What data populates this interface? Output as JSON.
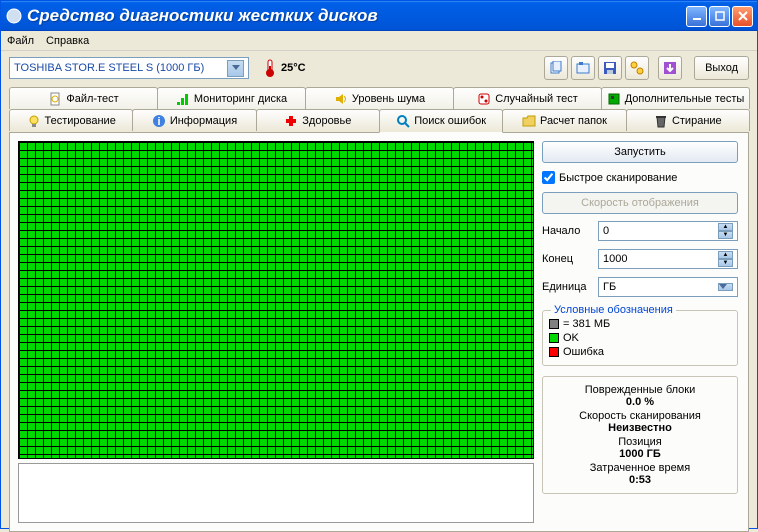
{
  "window": {
    "title": "Средство диагностики жестких дисков"
  },
  "menu": {
    "file": "Файл",
    "help": "Справка"
  },
  "toolbar": {
    "drive": "TOSHIBA STOR.E STEEL S  (1000 ГБ)",
    "temp": "25°C",
    "exit": "Выход"
  },
  "tabs_row1": [
    "Файл-тест",
    "Мониторинг диска",
    "Уровень шума",
    "Случайный тест",
    "Дополнительные тесты"
  ],
  "tabs_row2": [
    "Тестирование",
    "Информация",
    "Здоровье",
    "Поиск ошибок",
    "Расчет папок",
    "Стирание"
  ],
  "panel": {
    "start_btn": "Запустить",
    "quick_scan": "Быстрое сканирование",
    "display_speed": "Скорость отображения",
    "start_lbl": "Начало",
    "end_lbl": "Конец",
    "unit_lbl": "Единица",
    "start_val": "0",
    "end_val": "1000",
    "unit_val": "ГБ",
    "legend_title": "Условные обозначения",
    "legend_block": "= 381 МБ",
    "legend_ok": "OK",
    "legend_err": "Ошибка",
    "damaged_lbl": "Поврежденные блоки",
    "damaged_val": "0.0 %",
    "speed_lbl": "Скорость сканирования",
    "speed_val": "Неизвестно",
    "pos_lbl": "Позиция",
    "pos_val": "1000 ГБ",
    "elapsed_lbl": "Затраченное время",
    "elapsed_val": "0:53"
  },
  "colors": {
    "ok": "#00d900",
    "err": "#ff0000",
    "block": "#808080"
  }
}
